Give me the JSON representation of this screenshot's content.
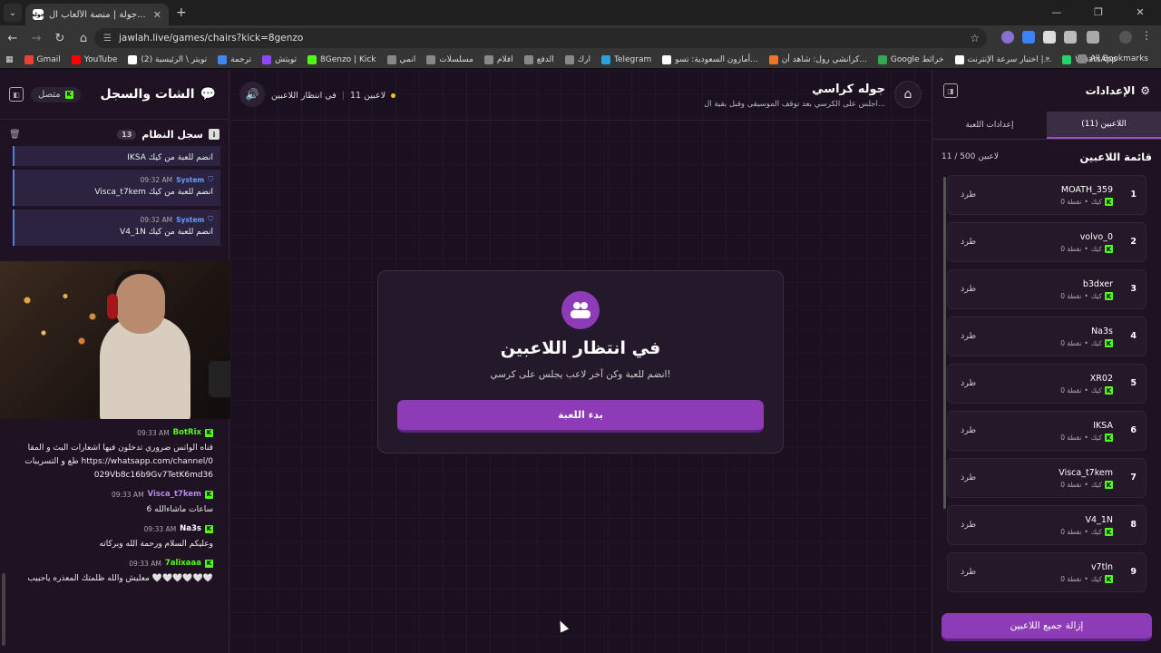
{
  "browser": {
    "tab_title": "جولة | منصة الألعاب ال... - Jawlah",
    "favicon_text": "جولة",
    "url": "jawlah.live/games/chairs?kick=8genzo",
    "bookmarks": [
      {
        "label": "Gmail",
        "color": "#ea4335"
      },
      {
        "label": "YouTube",
        "color": "#ff0000"
      },
      {
        "label": "(2) تويتر \\ الرئيسية",
        "color": "#ffffff"
      },
      {
        "label": "ترجمة",
        "color": "#4285f4"
      },
      {
        "label": "تويتش",
        "color": "#9146ff"
      },
      {
        "label": "8Genzo | Kick",
        "color": "#53fc18"
      },
      {
        "label": "انمي",
        "color": "#888888"
      },
      {
        "label": "مسلسلات",
        "color": "#888888"
      },
      {
        "label": "افلام",
        "color": "#888888"
      },
      {
        "label": "الدفع",
        "color": "#888888"
      },
      {
        "label": "ارك",
        "color": "#888888"
      },
      {
        "label": "Telegram",
        "color": "#2aa1dd"
      },
      {
        "label": "أمازون السعودية: تسو...",
        "color": "#ffffff"
      },
      {
        "label": "كرانشي رول: شاهد أن...",
        "color": "#f47521"
      },
      {
        "label": "Google خرائط",
        "color": "#34a853"
      },
      {
        "label": "اختبار سرعة الإنترنت |...",
        "color": "#ffffff"
      },
      {
        "label": "WhatsApp",
        "color": "#25d366"
      }
    ],
    "all_bookmarks": "All Bookmarks"
  },
  "chat": {
    "title": "الشات والسجل",
    "status": "متصل",
    "syslog_title": "سجل النظام",
    "syslog_count": "13",
    "syslog": [
      {
        "time": "",
        "name": "",
        "text": "IKSA انضم للعبة من كيك"
      },
      {
        "time": "09:32 AM",
        "name": "System",
        "text": "Visca_t7kem انضم للعبة من كيك"
      },
      {
        "time": "09:32 AM",
        "name": "System",
        "text": "V4_1N انضم للعبة من كيك"
      }
    ],
    "messages": [
      {
        "user": "BotRix",
        "color": "#53fc18",
        "time": "09:33 AM",
        "text": "قناه الواتس ضروري تدخلون فيها اشعارات البث و المقاطع و التسريبات https://whatsapp.com/channel/0029Vb8c16b9Gv7TetK6md36"
      },
      {
        "user": "Visca_t7kem",
        "color": "#b48be8",
        "time": "09:33 AM",
        "text": "6 ساعات ماشاءالله"
      },
      {
        "user": "Na3s",
        "color": "#ffffff",
        "time": "09:33 AM",
        "text": "وعليكم السلام ورحمة الله وبركاته"
      },
      {
        "user": "7alixaaa",
        "color": "#53fc18",
        "time": "09:33 AM",
        "text": "معليش والله ظلمتك المعذره ياحبيب 🤍🤍🤍🤍🤍🤍"
      }
    ]
  },
  "game": {
    "title": "جوله كراسي",
    "subtitle": "اجلس على الكرسي بعد توقف الموسيقى وقبل بقية ال...",
    "player_count": "11 لاعبين",
    "status": "في انتظار اللاعبين",
    "card_title": "في انتظار اللاعبين",
    "card_sub": "انضم للعبة وكن آخر لاعب يجلس على كرسي!",
    "start_button": "بدء اللعبة"
  },
  "settings": {
    "title": "الإعدادات",
    "tab_players": "اللاعبين (11)",
    "tab_game": "إعدادات اللعبة",
    "players_title": "قائمة اللاعبين",
    "players_count": "11 / 500 لاعبين",
    "kick_label": "طرد",
    "source_label": "كيك",
    "points_label": "0 نقطة",
    "players": [
      {
        "num": "1",
        "name": "MOATH_359"
      },
      {
        "num": "2",
        "name": "volvo_0"
      },
      {
        "num": "3",
        "name": "b3dxer"
      },
      {
        "num": "4",
        "name": "Na3s"
      },
      {
        "num": "5",
        "name": "XR02"
      },
      {
        "num": "6",
        "name": "IKSA"
      },
      {
        "num": "7",
        "name": "Visca_t7kem"
      },
      {
        "num": "8",
        "name": "V4_1N"
      },
      {
        "num": "9",
        "name": "v7tln"
      }
    ],
    "remove_all": "إزالة جميع اللاعبين"
  },
  "colors": {
    "accent": "#8e3bb8",
    "kick_green": "#53fc18",
    "system_blue": "#6b9bff"
  }
}
